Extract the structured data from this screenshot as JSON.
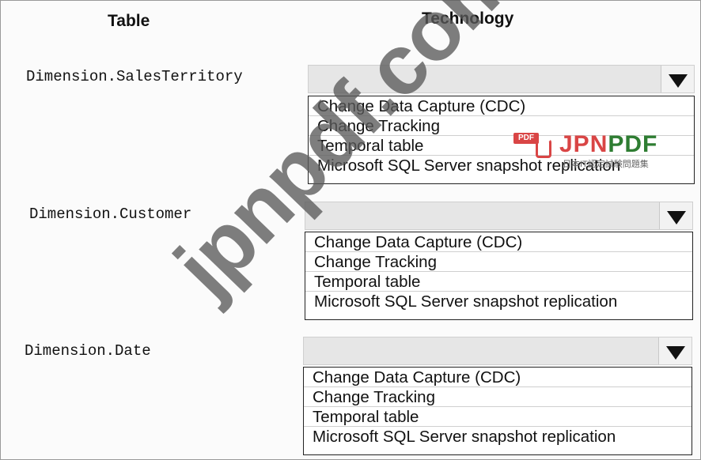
{
  "headers": {
    "table": "Table",
    "technology": "Technology"
  },
  "rows": [
    {
      "table": "Dimension.SalesTerritory",
      "selected": "",
      "options": [
        "Change Data Capture (CDC)",
        "Change Tracking",
        "Temporal table",
        "Microsoft SQL Server snapshot replication"
      ]
    },
    {
      "table": "Dimension.Customer",
      "selected": "",
      "options": [
        "Change Data Capture (CDC)",
        "Change Tracking",
        "Temporal table",
        "Microsoft SQL Server snapshot replication"
      ]
    },
    {
      "table": "Dimension.Date",
      "selected": "",
      "options": [
        "Change Data Capture (CDC)",
        "Change Tracking",
        "Temporal table",
        "Microsoft SQL Server snapshot replication"
      ]
    }
  ],
  "watermark": {
    "text": "jpnpdf.com"
  },
  "logo": {
    "badge": "PDF",
    "jpn": "JPN",
    "pdf": "PDF",
    "tagline": "日本IT認定試験問題集"
  },
  "colors": {
    "accent_red": "#d94545",
    "accent_green": "#2e7d32",
    "dropdown_bg": "#e6e6e6"
  },
  "icons": {
    "dropdown_arrow": "chevron-down-icon"
  }
}
